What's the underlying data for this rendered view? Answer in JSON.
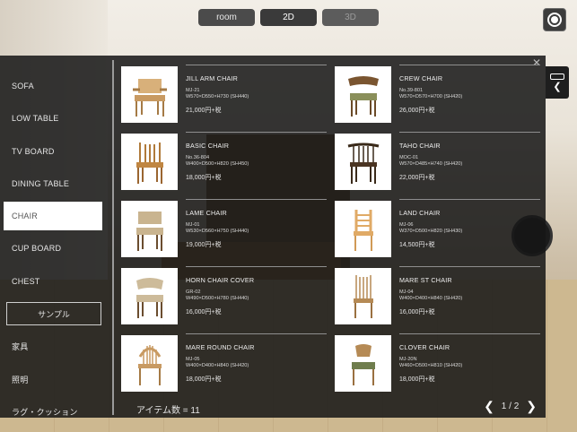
{
  "top_tabs": [
    {
      "label": "room",
      "state": "normal"
    },
    {
      "label": "2D",
      "state": "active"
    },
    {
      "label": "3D",
      "state": "disabled"
    }
  ],
  "sidebar": {
    "items": [
      {
        "label": "SOFA",
        "active": false
      },
      {
        "label": "LOW TABLE",
        "active": false
      },
      {
        "label": "TV BOARD",
        "active": false
      },
      {
        "label": "DINING TABLE",
        "active": false
      },
      {
        "label": "CHAIR",
        "active": true
      },
      {
        "label": "CUP BOARD",
        "active": false
      },
      {
        "label": "CHEST",
        "active": false
      }
    ],
    "sample_label": "サンプル",
    "extra_items": [
      {
        "label": "家具"
      },
      {
        "label": "照明"
      },
      {
        "label": "ラグ・クッション"
      }
    ]
  },
  "products": [
    {
      "name": "JILL ARM CHAIR",
      "code": "MJ-21",
      "size": "W570×D550×H730 (SH440)",
      "price": "21,000円+税"
    },
    {
      "name": "CREW CHAIR",
      "code": "No.39-801",
      "size": "W570×D570×H700 (SH420)",
      "price": "26,000円+税"
    },
    {
      "name": "BASIC CHAIR",
      "code": "No.36-804",
      "size": "W400×D500×H820 (SH450)",
      "price": "18,000円+税"
    },
    {
      "name": "TAHO CHAIR",
      "code": "MOC-01",
      "size": "W570×D485×H740 (SH420)",
      "price": "22,000円+税"
    },
    {
      "name": "LAME CHAIR",
      "code": "MJ-01",
      "size": "W530×D560×H750 (SH440)",
      "price": "19,000円+税"
    },
    {
      "name": "LAND CHAIR",
      "code": "MJ-06",
      "size": "W370×D500×H820 (SH430)",
      "price": "14,500円+税"
    },
    {
      "name": "HORN CHAIR COVER",
      "code": "GR-02",
      "size": "W490×D500×H780 (SH440)",
      "price": "16,000円+税"
    },
    {
      "name": "MARE ST CHAIR",
      "code": "MJ-04",
      "size": "W400×D400×H840 (SH420)",
      "price": "16,000円+税"
    },
    {
      "name": "MARE ROUND CHAIR",
      "code": "MJ-05",
      "size": "W400×D400×H840 (SH420)",
      "price": "18,000円+税"
    },
    {
      "name": "CLOVER CHAIR",
      "code": "MJ-20N",
      "size": "W460×D500×H810 (SH420)",
      "price": "18,000円+税"
    }
  ],
  "footer": {
    "item_count": "アイテム数 = 11",
    "page": "1 / 2"
  },
  "icons": {
    "close": "close-icon",
    "record": "record-icon",
    "prev": "chevron-left-icon",
    "next": "chevron-right-icon",
    "side": "sofa-icon"
  }
}
